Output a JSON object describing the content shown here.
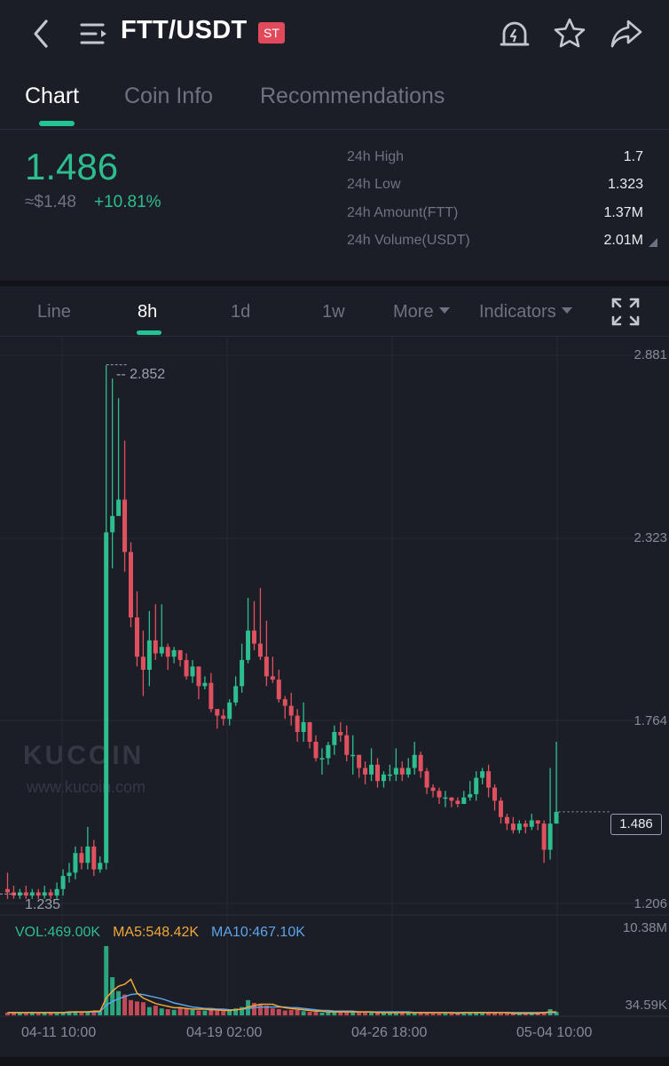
{
  "header": {
    "pair": "FTT/USDT",
    "badge": "ST",
    "icons": [
      "back-icon",
      "menu-icon",
      "alert-bell-icon",
      "star-icon",
      "share-icon"
    ]
  },
  "tabs": [
    {
      "label": "Chart",
      "active": true
    },
    {
      "label": "Coin Info",
      "active": false
    },
    {
      "label": "Recommendations",
      "active": false
    }
  ],
  "ticker": {
    "last_price": "1.486",
    "approx_usd": "≈$1.48",
    "change_pct": "+10.81%",
    "stats": [
      {
        "label": "24h High",
        "value": "1.7"
      },
      {
        "label": "24h Low",
        "value": "1.323"
      },
      {
        "label": "24h Amount(FTT)",
        "value": "1.37M"
      },
      {
        "label": "24h Volume(USDT)",
        "value": "2.01M"
      }
    ]
  },
  "intervals": {
    "items": [
      "Line",
      "8h",
      "1d",
      "1w"
    ],
    "active": "8h",
    "more_label": "More",
    "indicators_label": "Indicators"
  },
  "colors": {
    "up": "#2dbd8e",
    "down": "#e0515f",
    "ma5": "#f0a73a",
    "ma10": "#5da4ea",
    "accent": "#23c494"
  },
  "watermark": {
    "logo": "KUCOIN",
    "url": "www.kucoin.com"
  },
  "chart_data": {
    "type": "candlestick",
    "y_ticks": [
      "2.881",
      "2.323",
      "1.764",
      "1.206"
    ],
    "ylim": [
      1.206,
      2.881
    ],
    "x_ticks": [
      "04-11 10:00",
      "04-19 02:00",
      "04-26 18:00",
      "05-04 10:00"
    ],
    "max_label": "2.852",
    "min_label": "1.235",
    "current_price": "1.486",
    "candles": [
      [
        1.25,
        1.24,
        1.3,
        1.22
      ],
      [
        1.24,
        1.23,
        1.26,
        1.22
      ],
      [
        1.23,
        1.24,
        1.25,
        1.22
      ],
      [
        1.24,
        1.23,
        1.26,
        1.22
      ],
      [
        1.23,
        1.24,
        1.25,
        1.22
      ],
      [
        1.24,
        1.23,
        1.25,
        1.22
      ],
      [
        1.23,
        1.24,
        1.26,
        1.22
      ],
      [
        1.24,
        1.23,
        1.25,
        1.22
      ],
      [
        1.23,
        1.25,
        1.27,
        1.22
      ],
      [
        1.25,
        1.29,
        1.31,
        1.23
      ],
      [
        1.29,
        1.3,
        1.33,
        1.27
      ],
      [
        1.3,
        1.36,
        1.38,
        1.28
      ],
      [
        1.36,
        1.33,
        1.38,
        1.31
      ],
      [
        1.33,
        1.38,
        1.44,
        1.31
      ],
      [
        1.38,
        1.31,
        1.4,
        1.29
      ],
      [
        1.31,
        1.33,
        1.35,
        1.3
      ],
      [
        1.33,
        2.34,
        2.85,
        1.31
      ],
      [
        2.34,
        2.39,
        2.81,
        2.23
      ],
      [
        2.39,
        2.44,
        2.75,
        2.4
      ],
      [
        2.44,
        2.28,
        2.62,
        2.22
      ],
      [
        2.28,
        2.08,
        2.31,
        2.05
      ],
      [
        2.08,
        1.96,
        2.16,
        1.93
      ],
      [
        1.96,
        1.92,
        2.04,
        1.84
      ],
      [
        1.92,
        2.01,
        2.1,
        1.87
      ],
      [
        2.01,
        1.97,
        2.12,
        1.95
      ],
      [
        1.97,
        1.99,
        2.12,
        1.96
      ],
      [
        1.99,
        1.96,
        2.0,
        1.92
      ],
      [
        1.96,
        1.98,
        1.99,
        1.94
      ],
      [
        1.98,
        1.95,
        1.98,
        1.93
      ],
      [
        1.95,
        1.9,
        1.97,
        1.89
      ],
      [
        1.9,
        1.93,
        1.95,
        1.88
      ],
      [
        1.93,
        1.87,
        1.93,
        1.83
      ],
      [
        1.87,
        1.88,
        1.9,
        1.86
      ],
      [
        1.88,
        1.8,
        1.91,
        1.79
      ],
      [
        1.8,
        1.78,
        1.8,
        1.74
      ],
      [
        1.78,
        1.77,
        1.8,
        1.75
      ],
      [
        1.77,
        1.82,
        1.83,
        1.75
      ],
      [
        1.82,
        1.87,
        1.9,
        1.81
      ],
      [
        1.87,
        1.95,
        2.0,
        1.85
      ],
      [
        1.95,
        2.04,
        2.14,
        1.94
      ],
      [
        2.04,
        2.0,
        2.13,
        1.98
      ],
      [
        2.0,
        1.96,
        2.17,
        1.95
      ],
      [
        1.96,
        1.9,
        2.07,
        1.87
      ],
      [
        1.9,
        1.89,
        1.96,
        1.88
      ],
      [
        1.89,
        1.83,
        1.92,
        1.82
      ],
      [
        1.83,
        1.81,
        1.84,
        1.77
      ],
      [
        1.81,
        1.78,
        1.85,
        1.75
      ],
      [
        1.78,
        1.73,
        1.8,
        1.7
      ],
      [
        1.73,
        1.76,
        1.82,
        1.7
      ],
      [
        1.76,
        1.7,
        1.76,
        1.68
      ],
      [
        1.7,
        1.65,
        1.72,
        1.64
      ],
      [
        1.65,
        1.65,
        1.68,
        1.6
      ],
      [
        1.65,
        1.69,
        1.7,
        1.63
      ],
      [
        1.69,
        1.73,
        1.75,
        1.66
      ],
      [
        1.73,
        1.72,
        1.76,
        1.7
      ],
      [
        1.72,
        1.66,
        1.75,
        1.64
      ],
      [
        1.66,
        1.66,
        1.72,
        1.6
      ],
      [
        1.66,
        1.62,
        1.66,
        1.59
      ],
      [
        1.62,
        1.6,
        1.64,
        1.57
      ],
      [
        1.6,
        1.63,
        1.68,
        1.58
      ],
      [
        1.63,
        1.58,
        1.65,
        1.56
      ],
      [
        1.58,
        1.6,
        1.61,
        1.56
      ],
      [
        1.6,
        1.6,
        1.63,
        1.58
      ],
      [
        1.6,
        1.62,
        1.68,
        1.58
      ],
      [
        1.62,
        1.6,
        1.64,
        1.58
      ],
      [
        1.6,
        1.62,
        1.65,
        1.59
      ],
      [
        1.62,
        1.66,
        1.7,
        1.6
      ],
      [
        1.66,
        1.61,
        1.67,
        1.59
      ],
      [
        1.61,
        1.56,
        1.62,
        1.54
      ],
      [
        1.56,
        1.55,
        1.57,
        1.53
      ],
      [
        1.55,
        1.53,
        1.56,
        1.51
      ],
      [
        1.53,
        1.53,
        1.55,
        1.5
      ],
      [
        1.53,
        1.52,
        1.53,
        1.5
      ],
      [
        1.52,
        1.51,
        1.53,
        1.5
      ],
      [
        1.51,
        1.53,
        1.55,
        1.51
      ],
      [
        1.53,
        1.54,
        1.58,
        1.52
      ],
      [
        1.54,
        1.59,
        1.61,
        1.52
      ],
      [
        1.59,
        1.61,
        1.62,
        1.57
      ],
      [
        1.61,
        1.56,
        1.63,
        1.53
      ],
      [
        1.56,
        1.52,
        1.57,
        1.49
      ],
      [
        1.52,
        1.47,
        1.53,
        1.45
      ],
      [
        1.47,
        1.45,
        1.48,
        1.43
      ],
      [
        1.45,
        1.43,
        1.47,
        1.42
      ],
      [
        1.43,
        1.45,
        1.46,
        1.42
      ],
      [
        1.45,
        1.44,
        1.46,
        1.42
      ],
      [
        1.44,
        1.46,
        1.48,
        1.43
      ],
      [
        1.46,
        1.45,
        1.46,
        1.43
      ],
      [
        1.45,
        1.37,
        1.46,
        1.33
      ],
      [
        1.37,
        1.45,
        1.62,
        1.34
      ],
      [
        1.45,
        1.486,
        1.7,
        1.45
      ]
    ]
  },
  "volume": {
    "vol_label": "VOL:469.00K",
    "ma5_label": "MA5:548.42K",
    "ma10_label": "MA10:467.10K",
    "y_top": "10.38M",
    "y_bottom": "34.59K",
    "values": [
      0.04,
      0.04,
      0.04,
      0.03,
      0.04,
      0.03,
      0.04,
      0.04,
      0.04,
      0.05,
      0.05,
      0.06,
      0.05,
      0.06,
      0.06,
      0.06,
      1.0,
      0.55,
      0.35,
      0.3,
      0.22,
      0.2,
      0.19,
      0.12,
      0.14,
      0.1,
      0.09,
      0.08,
      0.12,
      0.1,
      0.08,
      0.07,
      0.07,
      0.08,
      0.07,
      0.06,
      0.08,
      0.1,
      0.12,
      0.22,
      0.18,
      0.16,
      0.14,
      0.1,
      0.09,
      0.07,
      0.08,
      0.08,
      0.06,
      0.05,
      0.05,
      0.04,
      0.05,
      0.06,
      0.06,
      0.05,
      0.05,
      0.04,
      0.04,
      0.05,
      0.04,
      0.04,
      0.04,
      0.05,
      0.05,
      0.04,
      0.04,
      0.05,
      0.04,
      0.03,
      0.03,
      0.03,
      0.04,
      0.03,
      0.04,
      0.04,
      0.05,
      0.05,
      0.04,
      0.04,
      0.03,
      0.03,
      0.03,
      0.03,
      0.03,
      0.04,
      0.03,
      0.05,
      0.09,
      0.05
    ],
    "ma5": [
      0.04,
      0.04,
      0.04,
      0.04,
      0.04,
      0.04,
      0.04,
      0.04,
      0.04,
      0.04,
      0.05,
      0.05,
      0.05,
      0.05,
      0.06,
      0.06,
      0.25,
      0.35,
      0.42,
      0.45,
      0.52,
      0.32,
      0.25,
      0.21,
      0.17,
      0.15,
      0.13,
      0.11,
      0.11,
      0.1,
      0.09,
      0.09,
      0.09,
      0.08,
      0.08,
      0.07,
      0.07,
      0.08,
      0.09,
      0.12,
      0.14,
      0.16,
      0.16,
      0.16,
      0.13,
      0.11,
      0.1,
      0.09,
      0.08,
      0.07,
      0.06,
      0.06,
      0.05,
      0.05,
      0.05,
      0.05,
      0.05,
      0.05,
      0.05,
      0.05,
      0.04,
      0.04,
      0.04,
      0.04,
      0.04,
      0.04,
      0.04,
      0.04,
      0.04,
      0.04,
      0.04,
      0.04,
      0.04,
      0.03,
      0.04,
      0.04,
      0.04,
      0.04,
      0.04,
      0.04,
      0.04,
      0.04,
      0.03,
      0.03,
      0.03,
      0.03,
      0.03,
      0.04,
      0.05,
      0.05
    ],
    "ma10": [
      0.04,
      0.04,
      0.04,
      0.04,
      0.04,
      0.04,
      0.04,
      0.04,
      0.04,
      0.04,
      0.04,
      0.05,
      0.05,
      0.05,
      0.05,
      0.05,
      0.15,
      0.2,
      0.24,
      0.27,
      0.3,
      0.31,
      0.3,
      0.28,
      0.26,
      0.24,
      0.21,
      0.18,
      0.16,
      0.14,
      0.12,
      0.11,
      0.1,
      0.1,
      0.09,
      0.09,
      0.08,
      0.08,
      0.09,
      0.1,
      0.11,
      0.12,
      0.12,
      0.12,
      0.12,
      0.12,
      0.11,
      0.11,
      0.1,
      0.09,
      0.08,
      0.07,
      0.07,
      0.06,
      0.06,
      0.06,
      0.06,
      0.05,
      0.05,
      0.05,
      0.05,
      0.05,
      0.05,
      0.05,
      0.05,
      0.05,
      0.04,
      0.04,
      0.04,
      0.04,
      0.04,
      0.04,
      0.04,
      0.04,
      0.04,
      0.04,
      0.04,
      0.04,
      0.04,
      0.04,
      0.04,
      0.04,
      0.04,
      0.04,
      0.04,
      0.04,
      0.04,
      0.04,
      0.04,
      0.04
    ]
  }
}
